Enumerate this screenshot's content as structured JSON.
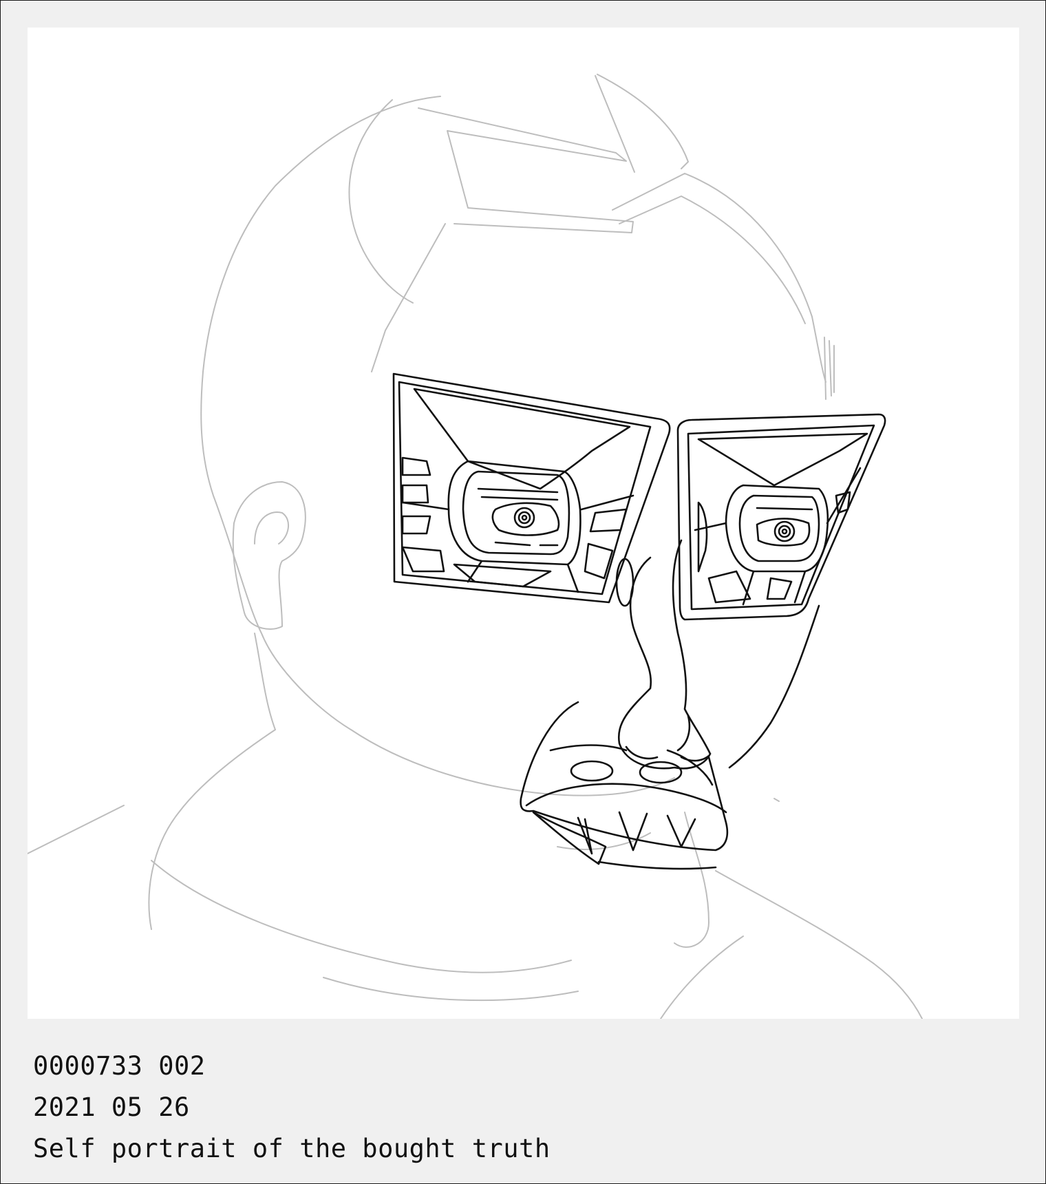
{
  "artwork": {
    "subject": "",
    "ink_color": "#111111",
    "sketch_color": "#bdbdbd",
    "background_color": "#ffffff",
    "frame_color": "#f0f0f0"
  },
  "caption": {
    "id_line": "0000733 002",
    "date_line": "2021 05 26",
    "title_line": "Self portrait of the bought truth"
  }
}
